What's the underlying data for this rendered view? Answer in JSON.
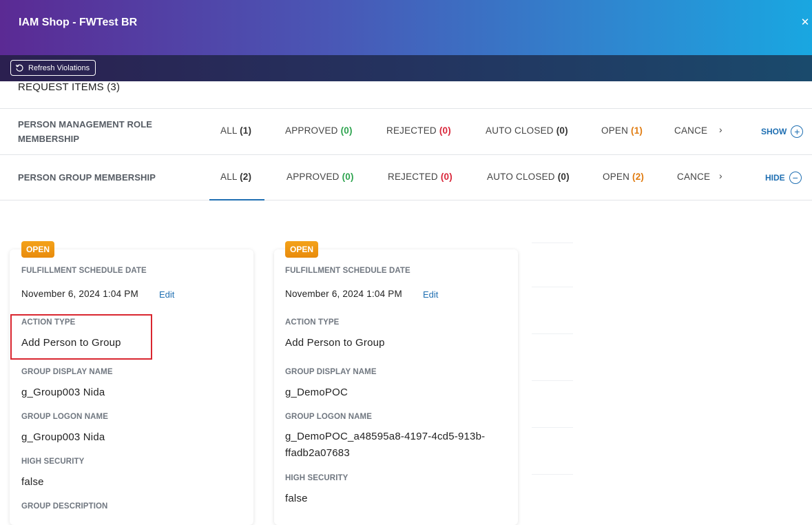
{
  "window": {
    "title": "IAM Shop - FWTest BR"
  },
  "toolbar": {
    "refresh_label": "Refresh Violations"
  },
  "request_items": {
    "title": "REQUEST ITEMS (3)"
  },
  "rows": [
    {
      "label": "PERSON MANAGEMENT ROLE MEMBERSHIP",
      "tabs": [
        {
          "name": "ALL",
          "count": "(1)"
        },
        {
          "name": "APPROVED",
          "count": "(0)"
        },
        {
          "name": "REJECTED",
          "count": "(0)"
        },
        {
          "name": "AUTO CLOSED",
          "count": "(0)"
        },
        {
          "name": "OPEN",
          "count": "(1)"
        },
        {
          "name": "CANCELLED"
        }
      ],
      "toggle": "SHOW"
    },
    {
      "label": "PERSON GROUP MEMBERSHIP",
      "tabs": [
        {
          "name": "ALL",
          "count": "(2)"
        },
        {
          "name": "APPROVED",
          "count": "(0)"
        },
        {
          "name": "REJECTED",
          "count": "(0)"
        },
        {
          "name": "AUTO CLOSED",
          "count": "(0)"
        },
        {
          "name": "OPEN",
          "count": "(2)"
        },
        {
          "name": "CANCELLED"
        }
      ],
      "toggle": "HIDE"
    }
  ],
  "cards": [
    {
      "status": "OPEN",
      "fields": {
        "schedule_label": "FULFILLMENT SCHEDULE DATE",
        "schedule_value": "November 6, 2024 1:04 PM",
        "edit": "Edit",
        "action_label": "ACTION TYPE",
        "action_value": "Add Person to Group",
        "display_label": "GROUP DISPLAY NAME",
        "display_value": "g_Group003 Nida",
        "logon_label": "GROUP LOGON NAME",
        "logon_value": "g_Group003 Nida",
        "security_label": "HIGH SECURITY",
        "security_value": "false",
        "description_label": "GROUP DESCRIPTION"
      }
    },
    {
      "status": "OPEN",
      "fields": {
        "schedule_label": "FULFILLMENT SCHEDULE DATE",
        "schedule_value": "November 6, 2024 1:04 PM",
        "edit": "Edit",
        "action_label": "ACTION TYPE",
        "action_value": "Add Person to Group",
        "display_label": "GROUP DISPLAY NAME",
        "display_value": "g_DemoPOC",
        "logon_label": "GROUP LOGON NAME",
        "logon_value": "g_DemoPOC_a48595a8-4197-4cd5-913b-ffadb2a07683",
        "security_label": "HIGH SECURITY",
        "security_value": "false"
      }
    }
  ],
  "colors": {
    "approved": "#2ea44f",
    "rejected": "#d9263a",
    "open": "#e07b10",
    "link": "#1f6fb2",
    "highlight": "#d9262f"
  },
  "icons": {
    "refresh": "refresh-icon",
    "close": "close-icon",
    "show": "plus-circle-icon",
    "hide": "minus-circle-icon",
    "chevron": "chevron-right-icon"
  }
}
